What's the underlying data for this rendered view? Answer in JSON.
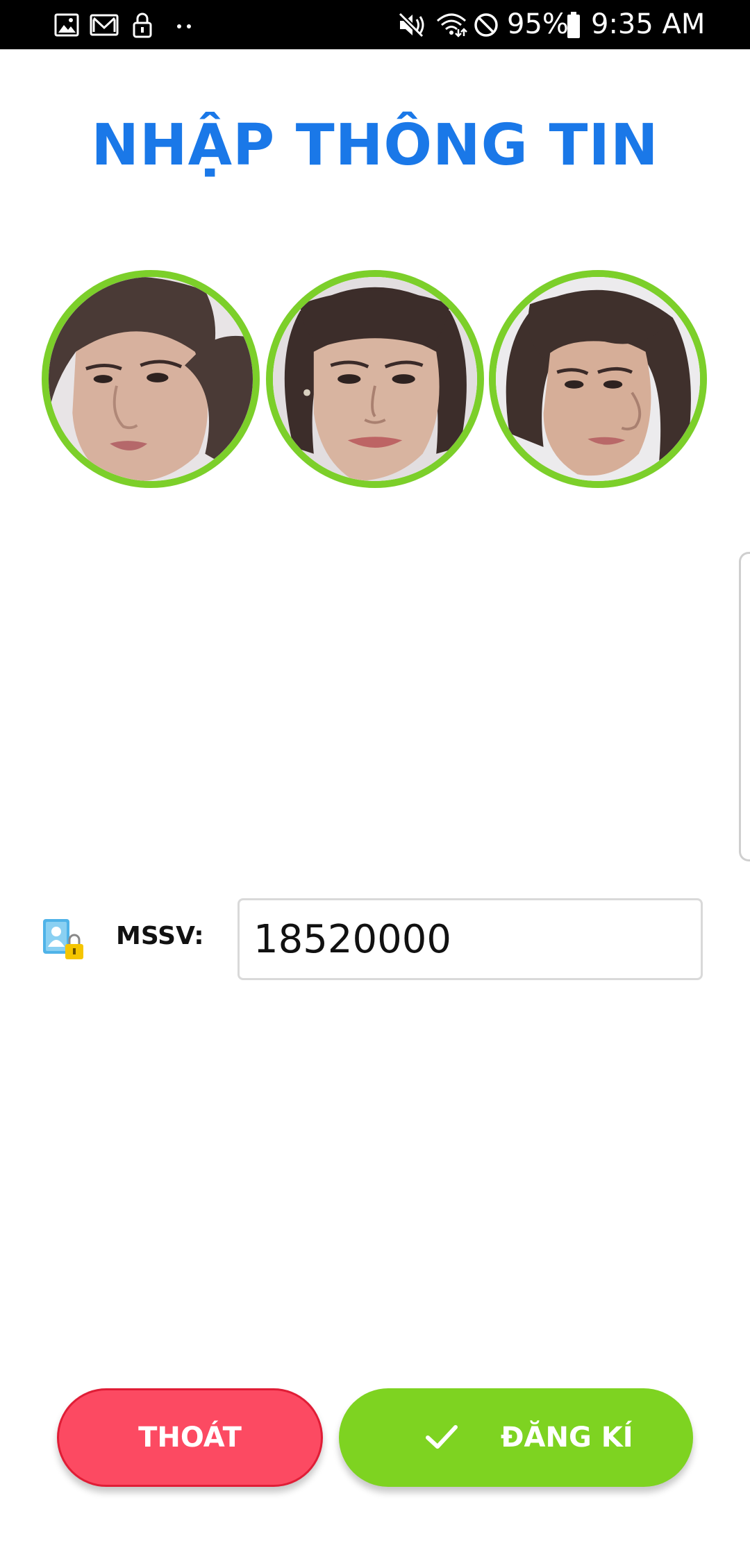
{
  "status_bar": {
    "battery": "95%",
    "time": "9:35 AM",
    "icons": [
      "gallery-icon",
      "mail-icon",
      "lock-icon",
      "more-dots-icon",
      "mute-icon",
      "wifi-icon",
      "blocked-icon",
      "battery-icon"
    ]
  },
  "title": "NHẬP THÔNG TIN",
  "faces": [
    {
      "name": "face-photo-left"
    },
    {
      "name": "face-photo-center"
    },
    {
      "name": "face-photo-right"
    }
  ],
  "form": {
    "mssv_label": "MSSV:",
    "mssv_value": "18520000",
    "icon": "student-id-lock-icon"
  },
  "buttons": {
    "exit_label": "THOÁT",
    "register_label": "ĐĂNG KÍ",
    "register_icon": "check-icon"
  },
  "colors": {
    "title": "#1a78e8",
    "face_border": "#7ccf2a",
    "exit_button": "#fc4a62",
    "register_button": "#7ed321"
  }
}
